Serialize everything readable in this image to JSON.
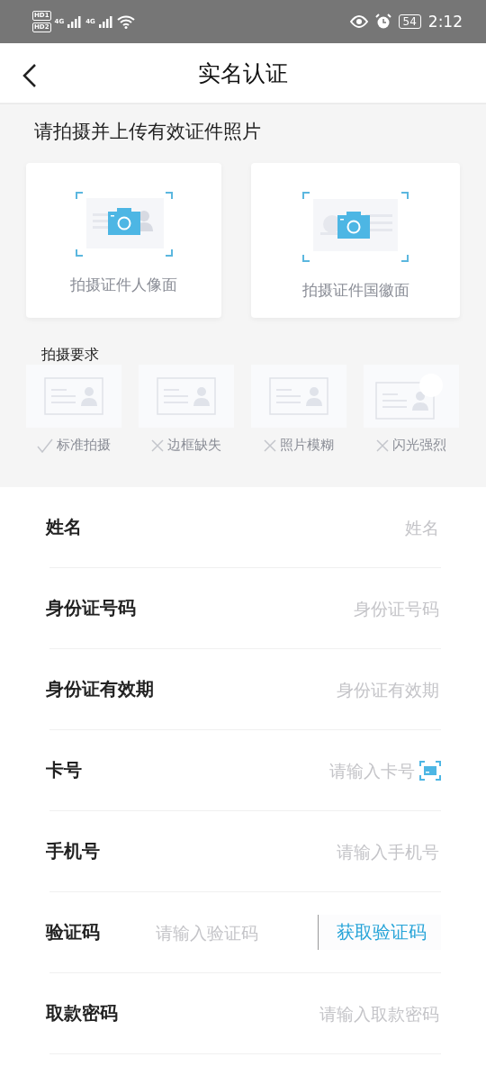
{
  "status_bar": {
    "sims": [
      {
        "hd": "HD",
        "slot": "1",
        "net": "4G"
      },
      {
        "hd": "HD",
        "slot": "2",
        "net": "4G"
      }
    ],
    "battery": "54",
    "time": "2:12"
  },
  "header": {
    "title": "实名认证"
  },
  "upload": {
    "heading": "请拍摄并上传有效证件照片",
    "cards": [
      {
        "kind": "portrait",
        "label": "拍摄证件人像面"
      },
      {
        "kind": "emblem",
        "label": "拍摄证件国徽面"
      }
    ],
    "requirements_title": "拍摄要求",
    "requirements": [
      {
        "label": "标准拍摄",
        "passed": true,
        "kind": "normal"
      },
      {
        "label": "边框缺失",
        "passed": false,
        "kind": "cropped"
      },
      {
        "label": "照片模糊",
        "passed": false,
        "kind": "blurry"
      },
      {
        "label": "闪光强烈",
        "passed": false,
        "kind": "flash"
      }
    ]
  },
  "form": [
    {
      "kind": "text",
      "label": "姓名",
      "placeholder": "姓名"
    },
    {
      "kind": "text",
      "label": "身份证号码",
      "placeholder": "身份证号码"
    },
    {
      "kind": "text",
      "label": "身份证有效期",
      "placeholder": "身份证有效期"
    },
    {
      "kind": "card",
      "label": "卡号",
      "placeholder": "请输入卡号"
    },
    {
      "kind": "text",
      "label": "手机号",
      "placeholder": "请输入手机号"
    },
    {
      "kind": "code",
      "label": "验证码",
      "placeholder": "请输入验证码",
      "action": "获取验证码"
    },
    {
      "kind": "text",
      "label": "取款密码",
      "placeholder": "请输入取款密码"
    }
  ]
}
